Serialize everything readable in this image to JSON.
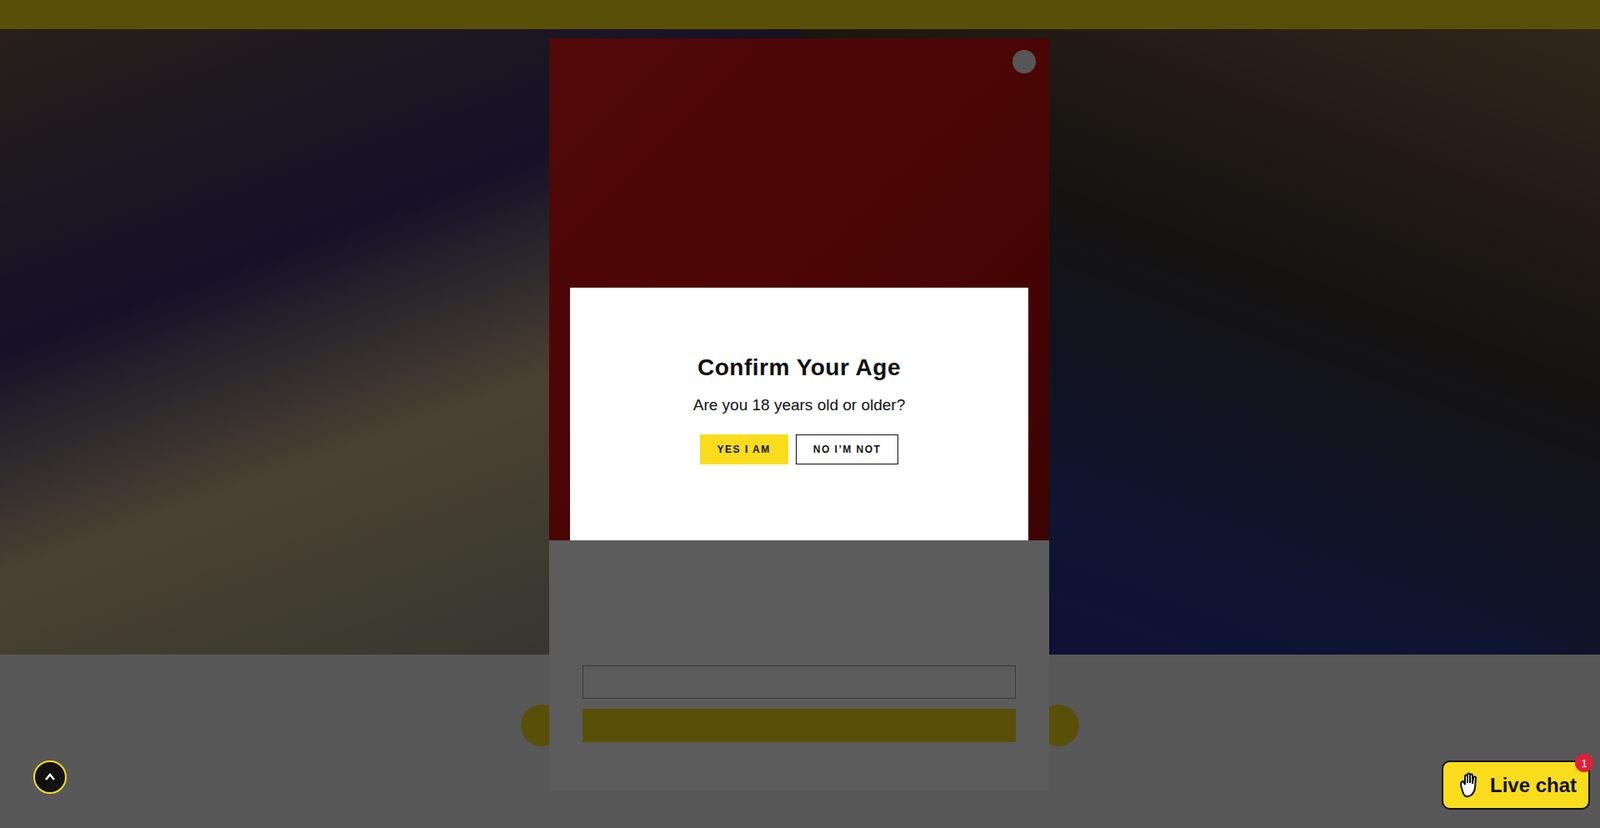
{
  "age_gate": {
    "title": "Confirm Your Age",
    "question": "Are you 18 years old or older?",
    "buttons": [
      {
        "label": "YES I AM",
        "kind": "primary"
      },
      {
        "label": "NO I’M NOT",
        "kind": "secondary"
      }
    ]
  },
  "live_chat": {
    "label": "Live chat",
    "badge": "1"
  }
}
